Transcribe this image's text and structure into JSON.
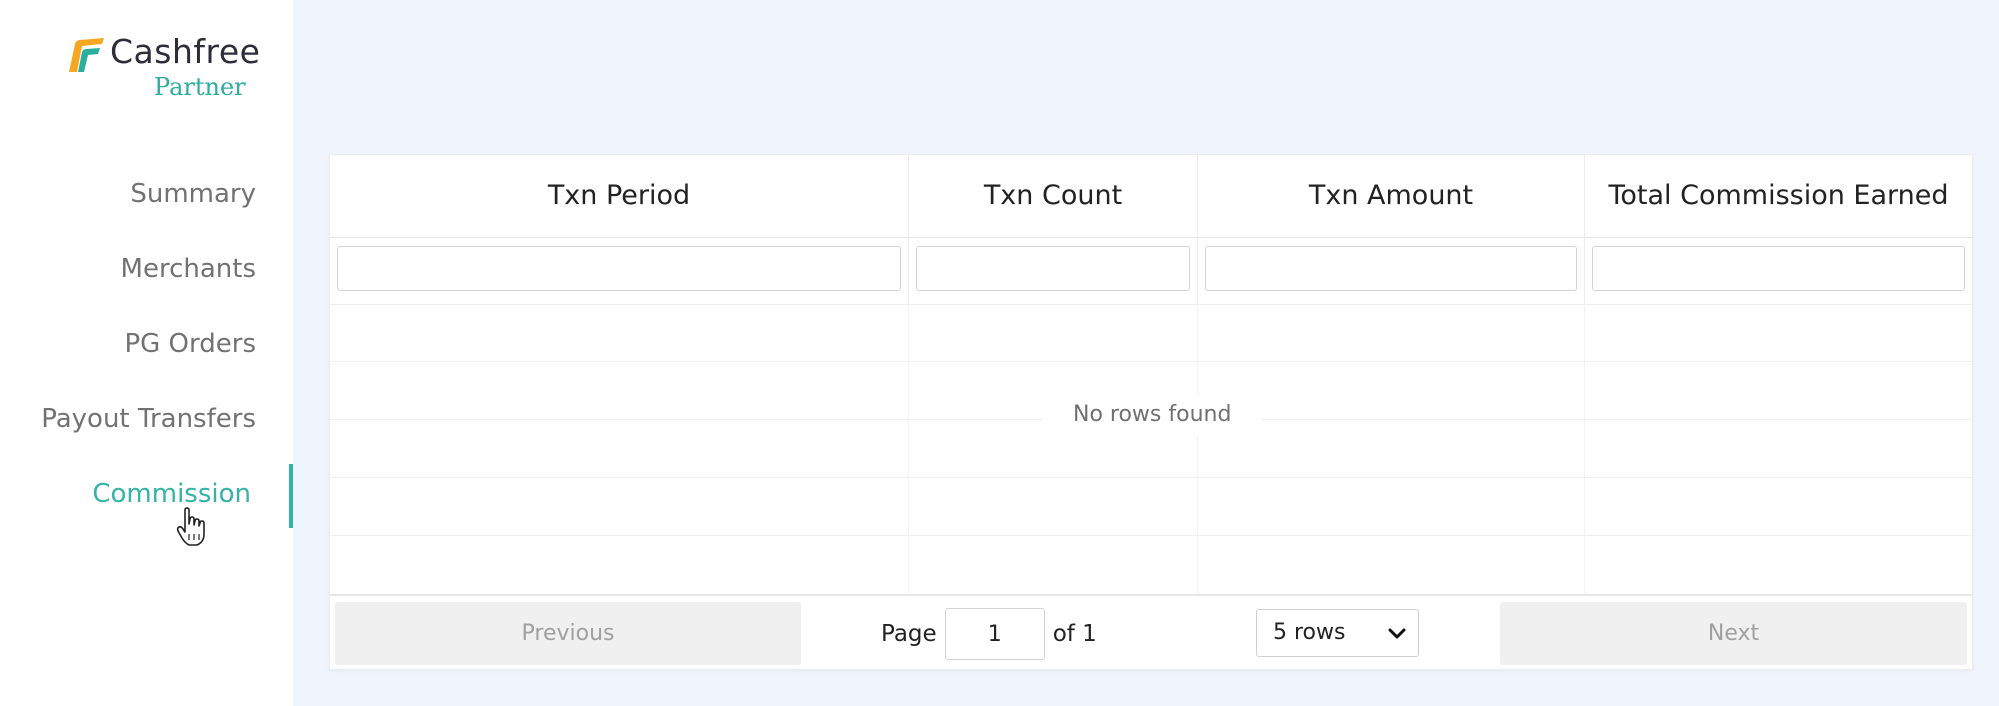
{
  "brand": {
    "name": "Cashfree",
    "sub": "Partner",
    "accent": "#35b3a6",
    "mark_colors": [
      "#f5a623",
      "#2bae9e"
    ]
  },
  "sidebar": {
    "items": [
      {
        "label": "Summary",
        "active": false
      },
      {
        "label": "Merchants",
        "active": false
      },
      {
        "label": "PG Orders",
        "active": false
      },
      {
        "label": "Payout Transfers",
        "active": false
      },
      {
        "label": "Commission",
        "active": true
      }
    ]
  },
  "table": {
    "columns": [
      "Txn Period",
      "Txn Count",
      "Txn Amount",
      "Total Commission Earned"
    ],
    "filters": [
      "",
      "",
      "",
      ""
    ],
    "rows": [],
    "empty_text": "No rows found"
  },
  "pagination": {
    "previous_label": "Previous",
    "next_label": "Next",
    "page_label": "Page",
    "current_page": "1",
    "of_label": "of 1",
    "rows_label": "5 rows"
  },
  "icons": {
    "cursor": "hand-pointer-icon",
    "select_arrow": "chevron-down-icon",
    "logo": "cashfree-logo-icon"
  }
}
